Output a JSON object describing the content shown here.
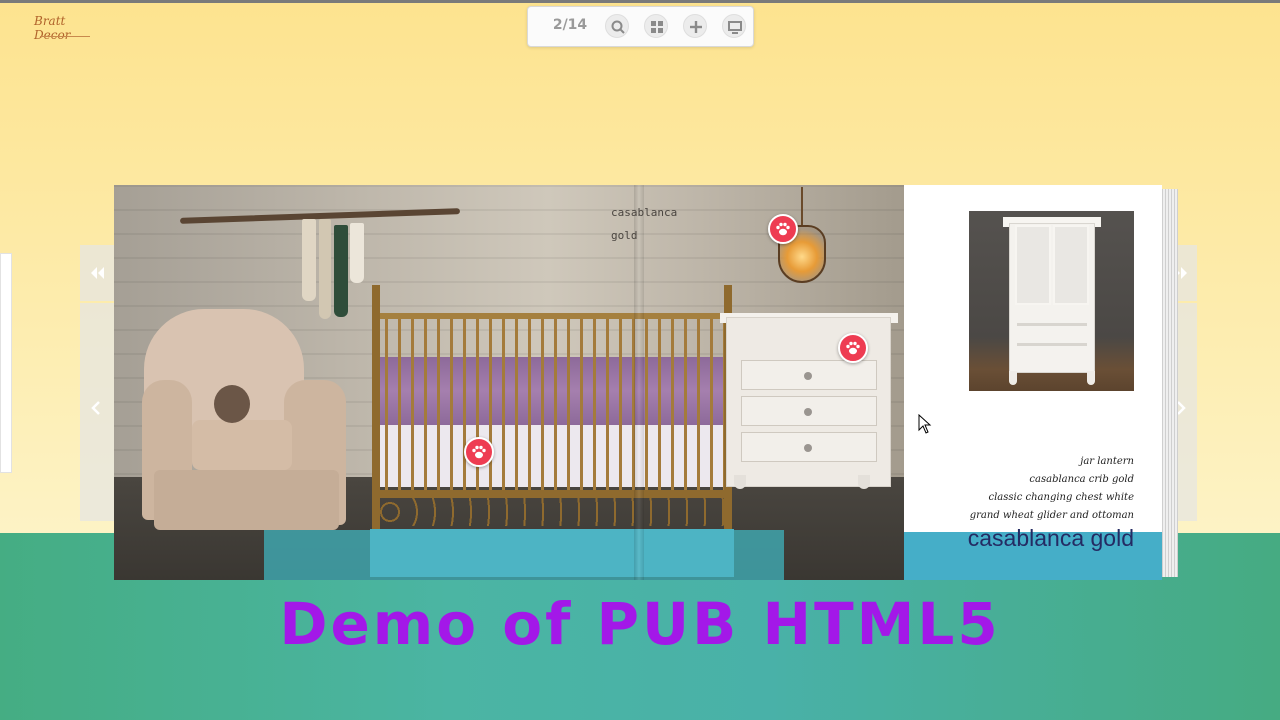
{
  "brand": {
    "logo_text": "Bratt Decor"
  },
  "toolbar": {
    "page_counter": "2/14",
    "buttons": [
      "search-icon",
      "thumbnails-icon",
      "zoom-in-icon",
      "fullscreen-icon"
    ]
  },
  "navigation": {
    "first_page": "double-chevron-left-icon",
    "prev_page": "chevron-left-icon",
    "last_page": "double-chevron-right-icon",
    "next_page": "chevron-right-icon"
  },
  "left_page": {
    "caption_line1": "casablanca",
    "caption_line2": "gold"
  },
  "right_page": {
    "products": [
      "jar lantern",
      "casablanca crib gold",
      "classic changing chest white",
      "grand wheat glider and ottoman"
    ],
    "title": "casablanca gold"
  },
  "demo_title": "Demo of PUB HTML5",
  "colors": {
    "hotspot": "#ee3c52",
    "title_purple": "#a318e8",
    "page_title_navy": "#242b63",
    "accent_teal": "#45aec8"
  }
}
